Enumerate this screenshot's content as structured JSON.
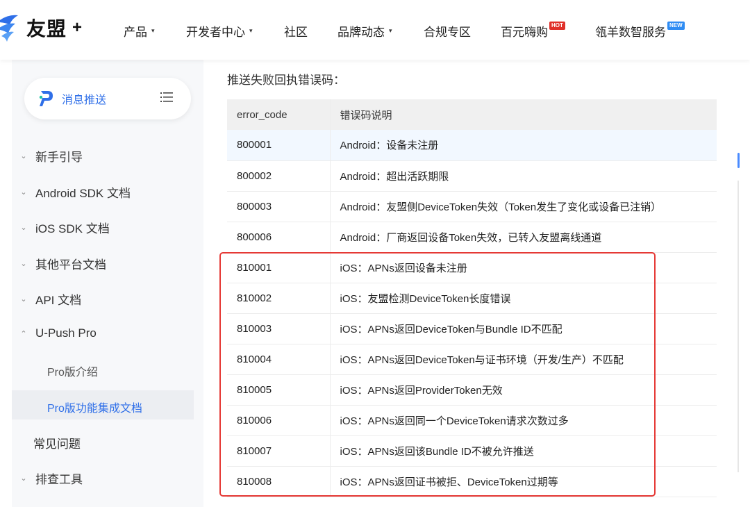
{
  "brand": {
    "name": "友盟",
    "plus": "+"
  },
  "nav": {
    "items": [
      {
        "label": "产品",
        "caret": "▾"
      },
      {
        "label": "开发者中心",
        "caret": "▾"
      },
      {
        "label": "社区"
      },
      {
        "label": "品牌动态",
        "caret": "▾"
      },
      {
        "label": "合规专区"
      },
      {
        "label": "百元嗨购",
        "badge": "HOT"
      },
      {
        "label": "瓴羊数智服务",
        "badge": "NEW"
      }
    ]
  },
  "sidebar": {
    "product": "消息推送",
    "items": [
      {
        "label": "新手引导",
        "chev": "⌄"
      },
      {
        "label": "Android SDK 文档",
        "chev": "⌄"
      },
      {
        "label": "iOS SDK 文档",
        "chev": "⌄"
      },
      {
        "label": "其他平台文档",
        "chev": "⌄"
      },
      {
        "label": "API 文档",
        "chev": "⌄"
      },
      {
        "label": "U-Push Pro",
        "chev": "⌃"
      }
    ],
    "subitems": [
      {
        "label": "Pro版介绍"
      },
      {
        "label": "Pro版功能集成文档"
      }
    ],
    "faq": "常见问题",
    "tools": {
      "label": "排查工具",
      "chev": "⌄"
    }
  },
  "content": {
    "title": "推送失败回执错误码：",
    "table": {
      "headers": [
        "error_code",
        "错误码说明"
      ],
      "rows": [
        [
          "800001",
          "Android：设备未注册"
        ],
        [
          "800002",
          "Android：超出活跃期限"
        ],
        [
          "800003",
          "Android：友盟侧DeviceToken失效（Token发生了变化或设备已注销）"
        ],
        [
          "800006",
          "Android：厂商返回设备Token失效，已转入友盟离线通道"
        ],
        [
          "810001",
          "iOS：APNs返回设备未注册"
        ],
        [
          "810002",
          "iOS：友盟检测DeviceToken长度错误"
        ],
        [
          "810003",
          "iOS：APNs返回DeviceToken与Bundle ID不匹配"
        ],
        [
          "810004",
          "iOS：APNs返回DeviceToken与证书环境（开发/生产）不匹配"
        ],
        [
          "810005",
          "iOS：APNs返回ProviderToken无效"
        ],
        [
          "810006",
          "iOS：APNs返回同一个DeviceToken请求次数过多"
        ],
        [
          "810007",
          "iOS：APNs返回该Bundle ID不被允许推送"
        ],
        [
          "810008",
          "iOS：APNs返回证书被拒、DeviceToken过期等"
        ]
      ]
    }
  },
  "colors": {
    "accent": "#2f6fe8",
    "highlight": "#e53935",
    "hot": "#e0302a",
    "new": "#2f8cf3"
  }
}
